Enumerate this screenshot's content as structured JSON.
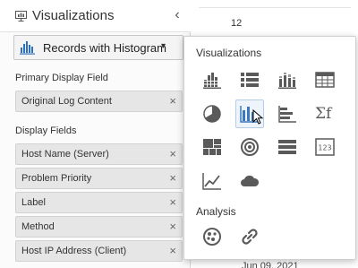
{
  "panel": {
    "title": "Visualizations",
    "collapse_glyph": "‹",
    "type_selector": {
      "label": "Records with Histogram",
      "caret": "▾",
      "icon": "histogram-icon"
    },
    "primary_label": "Primary Display Field",
    "primary_field": {
      "label": "Original Log Content",
      "remove": "×"
    },
    "display_label": "Display Fields",
    "display_fields": [
      {
        "label": "Host Name (Server)",
        "remove": "×"
      },
      {
        "label": "Problem Priority",
        "remove": "×"
      },
      {
        "label": "Label",
        "remove": "×"
      },
      {
        "label": "Method",
        "remove": "×"
      },
      {
        "label": "Host IP Address (Client)",
        "remove": "×"
      }
    ]
  },
  "background": {
    "top_number": "12",
    "bottom_date": "Jun 09, 2021"
  },
  "popup": {
    "visualizations_heading": "Visualizations",
    "analysis_heading": "Analysis",
    "selected_tile": "bar-chart-icon",
    "colors": {
      "icon": "#5a5a5a",
      "accent": "#3b78c2",
      "selected_bg": "#eef4fb"
    },
    "visualization_icons": [
      "histogram-icon",
      "records-list-icon",
      "stacked-bar-icon",
      "table-grid-icon",
      "pie-chart-icon",
      "bar-chart-icon",
      "horizontal-bar-icon",
      "summary-sigma-icon",
      "treemap-icon",
      "sunburst-icon",
      "distinct-list-icon",
      "tile-number-icon",
      "line-chart-icon",
      "word-cloud-icon"
    ],
    "analysis_icons": [
      "cluster-icon",
      "link-icon"
    ],
    "sigma_label": "Σf",
    "tile_number": "123"
  }
}
